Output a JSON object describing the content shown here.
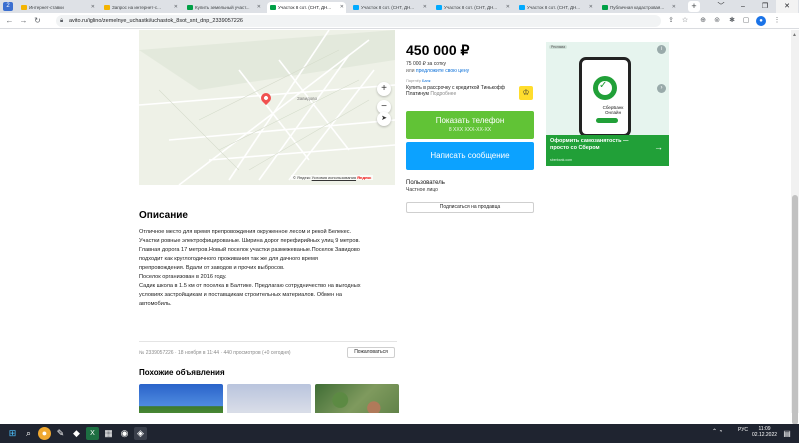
{
  "browser": {
    "profile_icon": "2",
    "tabs": [
      {
        "label": "Интернет-ставки",
        "active": false,
        "color": "#f4b400"
      },
      {
        "label": "Запрос на интернет-с...",
        "active": false,
        "color": "#f4b400"
      },
      {
        "label": "Купить земельный участ...",
        "active": false,
        "color": "#00a046"
      },
      {
        "label": "Участок 8 сот. (СНТ, ДН...",
        "active": true,
        "color": "#00a046"
      },
      {
        "label": "Участок 8 сот. (СНТ, ДН...",
        "active": false,
        "color": "#00aaff"
      },
      {
        "label": "Участок 8 сот. (СНТ, ДН...",
        "active": false,
        "color": "#00aaff"
      },
      {
        "label": "Участок 8 сот. (СНТ, ДН...",
        "active": false,
        "color": "#00aaff"
      },
      {
        "label": "Публичная кадастровая...",
        "active": false,
        "color": "#00a046"
      }
    ],
    "new_tab": "+",
    "url": "avito.ru/iglino/zemelnye_uchastki/uchastok_8sot_snt_dnp_2339057226",
    "window_controls": [
      "﹀",
      "–",
      "❐",
      "✕"
    ]
  },
  "listing": {
    "price": "450 000 ₽",
    "price_per": "75 000 ₽ за сотку",
    "offer_prefix": "или ",
    "offer_link": "предложите свою цену",
    "partner_label": "Партнёр",
    "partner_name": "Банк",
    "installment_text": "Купить в рассрочку с кредиткой Тинькофф Платинум",
    "installment_more": "Подробнее",
    "call_button": "Показать телефон",
    "call_masked": "8 XXX XXX-XX-XX",
    "message_button": "Написать сообщение",
    "seller_label": "Пользователь",
    "seller_type": "Частное лицо",
    "subscribe_button": "Подписаться на продавца"
  },
  "map": {
    "place_label": "Завидово",
    "zoom_in": "+",
    "zoom_out": "−",
    "locate": "➤",
    "footer_prefix": "© Яндекс ",
    "footer_link": "Условия использования",
    "footer_brand": "Яндекс"
  },
  "description": {
    "title": "Описание",
    "lines": [
      "Отличное место для время препровождения окруженное лесом и рекой Белекес.",
      "Участки ровные электрофицированые. Ширина дорог перефирийных улиц 9 метров.",
      "Главная дорога 17 метров.Новый поселок участки размежеваные.Поселок Завидово",
      "подходит как круглогодичного проживания так же для дачного время",
      "препровождения. Вдали от заводов и прочих выбросов.",
      "Поселок организован в 2016 году.",
      "Садик школа в 1.5 км от поселка в Балтике. Предлагаю сотрудничество на выгодных",
      "условиях застройщикам и поставщикам строительных материалов. Обмен на",
      "автомобиль."
    ],
    "meta": "№ 2339057226 · 18 ноября в 11:44 · 440 просмотров (+0 сегодня)",
    "report_button": "Пожаловаться",
    "similar_title": "Похожие объявления"
  },
  "ad": {
    "badge": "Реклама",
    "info": "i",
    "phone_label": "СберБанк Онлайн",
    "headline": "Оформить самозанятость — просто со Сбером",
    "domain": "sberbank.com",
    "arrow": "→"
  },
  "taskbar": {
    "tray_lang": "РУС",
    "time": "11:09",
    "date": "02.12.2022"
  },
  "colors": {
    "call_green": "#61c336",
    "message_blue": "#0ca2ff",
    "sber_green": "#21a038"
  }
}
